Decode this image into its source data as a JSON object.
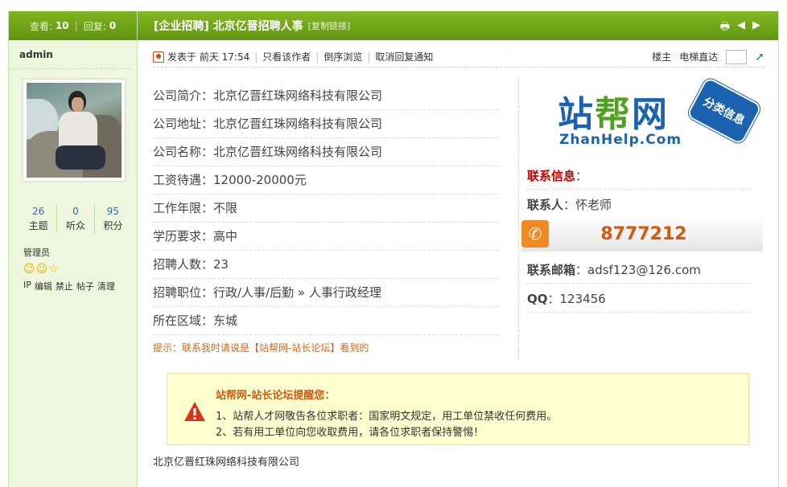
{
  "sidebar": {
    "views_label": "查看:",
    "views": "10",
    "replies_label": "回复:",
    "replies": "0",
    "username": "admin",
    "stats": [
      {
        "num": "26",
        "label": "主题"
      },
      {
        "num": "0",
        "label": "听众"
      },
      {
        "num": "95",
        "label": "积分"
      }
    ],
    "rank": "管理员",
    "admin_links": [
      "IP",
      "编辑",
      "禁止",
      "帖子",
      "清理"
    ]
  },
  "header": {
    "title": "[企业招聘] 北京亿晋招聘人事",
    "copy_link": "[复制链接]",
    "tools": [
      "print-icon",
      "prev-icon",
      "next-icon"
    ]
  },
  "meta": {
    "posted_prefix": "发表于",
    "posted_time": "前天 17:54",
    "author_only": "只看该作者",
    "reverse": "倒序浏览",
    "cancel_notify": "取消回复通知",
    "floor_owner": "楼主",
    "jump": "电梯直达"
  },
  "fields": [
    "公司简介：北京亿晋红珠网络科技有限公司",
    "公司地址：北京亿晋红珠网络科技有限公司",
    "公司名称：北京亿晋红珠网络科技有限公司",
    "工资待遇：12000-20000元",
    "工作年限：不限",
    "学历要求：高中",
    "招聘人数：23",
    "招聘职位：行政/人事/后勤 » 人事行政经理",
    "所在区域：东城"
  ],
  "tip": "提示：联系我时请说是【站帮网-站长论坛】看到的",
  "logo": {
    "cn_a": "站",
    "cn_b": "帮",
    "cn_c": "网",
    "en": "ZhanHelp.Com",
    "badge": "分类信息"
  },
  "contact": {
    "heading": "联系信息",
    "heading_colon": "：",
    "person_label": "联系人",
    "person": "：怀老师",
    "phone": "8777212",
    "email_label": "联系邮箱",
    "email": "：adsf123@126.com",
    "qq_label": "QQ",
    "qq": "：123456"
  },
  "notice": {
    "title": "站帮网-站长论坛提醒您：",
    "line1": "1、站帮人才网敬告各位求职者：国家明文规定，用工单位禁收任何费用。",
    "line2": "2、若有用工单位向您收取费用，请各位求职者保持警惕！"
  },
  "footer": "北京亿晋红珠网络科技有限公司",
  "colors": {
    "header_green": "#6aa318",
    "sidebar_bg": "#eef7de",
    "tip_orange": "#d26a1a",
    "phone_orange": "#f08a24",
    "contact_red": "#c80000"
  }
}
